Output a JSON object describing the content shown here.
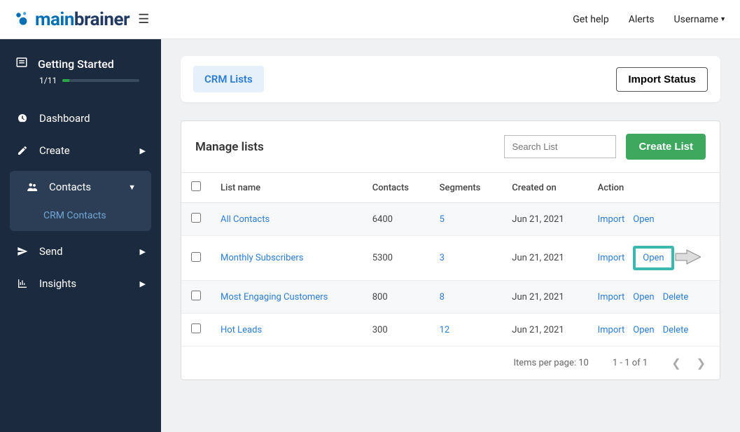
{
  "header": {
    "logo_main": "main",
    "logo_brainer": "brainer",
    "get_help": "Get help",
    "alerts": "Alerts",
    "username": "Username"
  },
  "sidebar": {
    "getting_started": {
      "label": "Getting Started",
      "progress": "1/11"
    },
    "items": [
      {
        "label": "Dashboard"
      },
      {
        "label": "Create"
      },
      {
        "label": "Contacts"
      },
      {
        "label": "Send"
      },
      {
        "label": "Insights"
      }
    ],
    "sub_contacts": "CRM Contacts"
  },
  "top": {
    "crm_tab": "CRM Lists",
    "import_status": "Import Status"
  },
  "list": {
    "title": "Manage lists",
    "search_placeholder": "Search List",
    "create_btn": "Create List",
    "columns": {
      "name": "List name",
      "contacts": "Contacts",
      "segments": "Segments",
      "created": "Created on",
      "action": "Action"
    },
    "rows": [
      {
        "name": "All Contacts",
        "contacts": "6400",
        "segments": "5",
        "created": "Jun 21, 2021",
        "actions": [
          "Import",
          "Open"
        ]
      },
      {
        "name": "Monthly Subscribers",
        "contacts": "5300",
        "segments": "3",
        "created": "Jun 21, 2021",
        "actions": [
          "Import",
          "Open"
        ]
      },
      {
        "name": "Most Engaging Customers",
        "contacts": "800",
        "segments": "8",
        "created": "Jun 21, 2021",
        "actions": [
          "Import",
          "Open",
          "Delete"
        ]
      },
      {
        "name": "Hot Leads",
        "contacts": "300",
        "segments": "12",
        "created": "Jun 21, 2021",
        "actions": [
          "Import",
          "Open",
          "Delete"
        ]
      }
    ],
    "per_page": "Items per page: 10",
    "range": "1 - 1 of 1"
  }
}
